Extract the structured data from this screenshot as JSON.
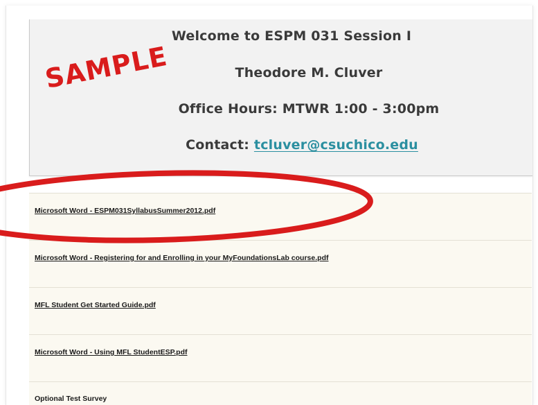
{
  "header": {
    "welcome": "Welcome to ESPM 031 Session I",
    "instructor": "Theodore M. Cluver",
    "office_hours": "Office Hours: MTWR 1:00 - 3:00pm",
    "contact_label": "Contact:",
    "contact_email": "tcluver@csuchico.edu"
  },
  "watermark": "SAMPLE",
  "files": [
    {
      "label": "Microsoft Word - ESPM031SyllabusSummer2012.pdf"
    },
    {
      "label": "Microsoft Word - Registering for and Enrolling in your MyFoundationsLab course.pdf"
    },
    {
      "label": "MFL Student Get Started Guide.pdf"
    },
    {
      "label": "Microsoft Word - Using MFL StudentESP.pdf"
    },
    {
      "label": "Optional Test Survey"
    }
  ],
  "colors": {
    "annotation_red": "#d91c1c",
    "link_teal": "#2b8fa0",
    "panel_bg": "#f2f2f2",
    "row_bg": "#fbf9f1"
  }
}
